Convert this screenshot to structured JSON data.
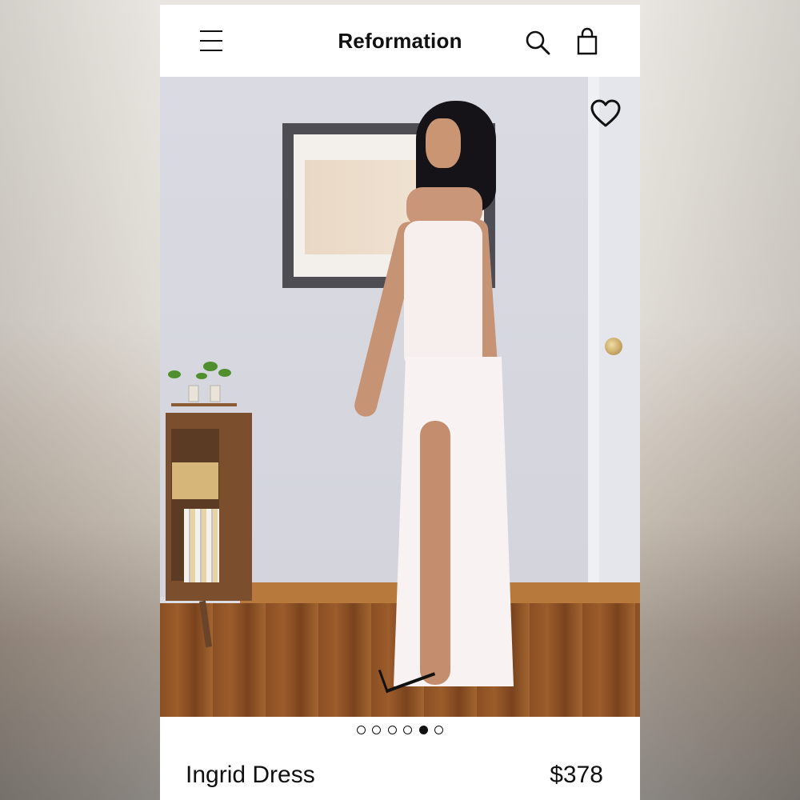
{
  "header": {
    "brand": "Reformation",
    "menu_icon": "hamburger-menu-icon",
    "search_icon": "search-icon",
    "bag_icon": "shopping-bag-icon"
  },
  "gallery": {
    "favorite_icon": "heart-icon",
    "pager": {
      "total": 6,
      "active_index": 4
    }
  },
  "product": {
    "name": "Ingrid Dress",
    "price": "$378"
  },
  "colors": {
    "text": "#111111",
    "background": "#ffffff"
  }
}
